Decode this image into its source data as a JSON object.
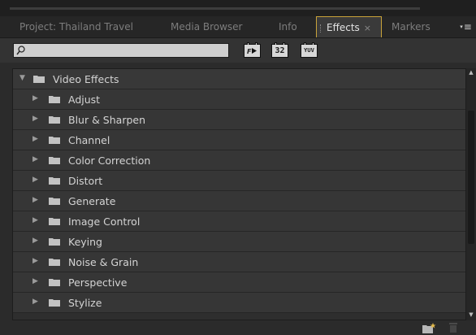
{
  "tabs": [
    {
      "label": "Project: Thailand Travel",
      "active": false
    },
    {
      "label": "Media Browser",
      "active": false
    },
    {
      "label": "Info",
      "active": false
    },
    {
      "label": "Effects",
      "active": true
    },
    {
      "label": "Markers",
      "active": false
    }
  ],
  "panel_menu_icon": "panel-menu-icon",
  "search": {
    "value": "",
    "placeholder": ""
  },
  "filter_buttons": [
    {
      "name": "accelerated-effects",
      "icon": "accelerated-icon"
    },
    {
      "name": "32-bit-effects",
      "label": "32"
    },
    {
      "name": "yuv-effects",
      "label": "YUV"
    }
  ],
  "tree": {
    "root": {
      "label": "Video Effects",
      "expanded": true
    },
    "children": [
      "Adjust",
      "Blur & Sharpen",
      "Channel",
      "Color Correction",
      "Distort",
      "Generate",
      "Image Control",
      "Keying",
      "Noise & Grain",
      "Perspective",
      "Stylize"
    ]
  },
  "bottom": {
    "new_bin_icon": "new-custom-bin-icon",
    "delete_icon": "trash-icon"
  },
  "colors": {
    "accent_border": "#c9a33a",
    "folder": "#c2c2c2",
    "panel": "#2b2b2b"
  }
}
